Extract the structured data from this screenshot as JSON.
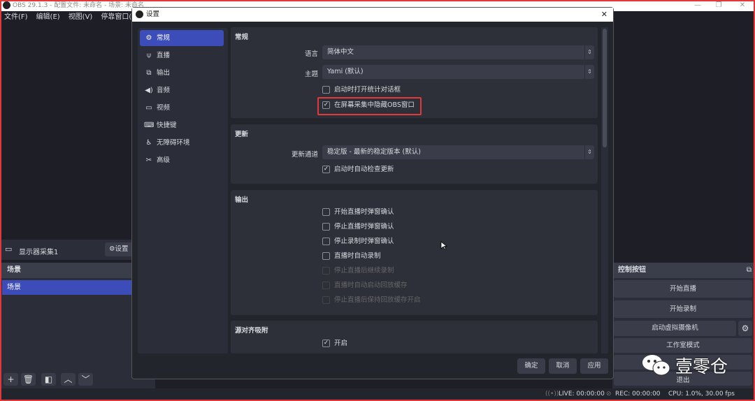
{
  "app": {
    "title": "OBS 29.1.3 - 配置文件: 未命名 - 场景: 未命名",
    "window_controls": [
      "minimize",
      "restore",
      "close"
    ]
  },
  "menu": [
    "文件(F)",
    "编辑(E)",
    "视图(V)",
    "停靠窗口(D)"
  ],
  "source_toolbar": {
    "source_name": "显示器采集1",
    "settings_label": "设置"
  },
  "scenes": {
    "header": "场景",
    "items": [
      "场景"
    ],
    "selected": 0
  },
  "controls": {
    "header": "控制按钮",
    "buttons": [
      "开始直播",
      "开始录制",
      "启动虚拟摄像机",
      "工作室模式",
      "",
      "退出"
    ]
  },
  "status": {
    "live": "LIVE: 00:00:00",
    "rec": "REC: 00:00:00",
    "cpu": "CPU: 1.0%, 30.00 fps"
  },
  "watermark": {
    "text": "壹零仓"
  },
  "settings": {
    "title": "设置",
    "sidebar": [
      {
        "label": "常规",
        "icon": "gear-icon"
      },
      {
        "label": "直播",
        "icon": "antenna-icon"
      },
      {
        "label": "输出",
        "icon": "output-icon"
      },
      {
        "label": "音频",
        "icon": "speaker-icon"
      },
      {
        "label": "视频",
        "icon": "monitor-icon"
      },
      {
        "label": "快捷键",
        "icon": "keyboard-icon"
      },
      {
        "label": "无障碍环境",
        "icon": "accessibility-icon"
      },
      {
        "label": "高级",
        "icon": "tools-icon"
      }
    ],
    "active": 0,
    "general": {
      "header": "常规",
      "language_label": "语言",
      "language": "简体中文",
      "theme_label": "主题",
      "theme": "Yami (默认)",
      "open_stats": "启动时打开统计对话框",
      "hide_obs": "在屏幕采集中隐藏OBS窗口",
      "open_stats_checked": false,
      "hide_obs_checked": true
    },
    "update": {
      "header": "更新",
      "channel_label": "更新通道",
      "channel": "稳定版 - 最新的稳定版本 (默认)",
      "auto_check": "启动时自动检查更新",
      "auto_check_checked": true
    },
    "output": {
      "header": "输出",
      "options": [
        {
          "label": "开始直播时弹窗确认",
          "checked": false,
          "disabled": false
        },
        {
          "label": "停止直播时弹窗确认",
          "checked": false,
          "disabled": false
        },
        {
          "label": "停止录制时弹窗确认",
          "checked": false,
          "disabled": false
        },
        {
          "label": "直播时自动录制",
          "checked": false,
          "disabled": false
        },
        {
          "label": "停止直播后继续录制",
          "checked": false,
          "disabled": true
        },
        {
          "label": "直播时自动启动回放缓存",
          "checked": false,
          "disabled": true
        },
        {
          "label": "停止直播后保持回放缓存开启",
          "checked": false,
          "disabled": true
        }
      ]
    },
    "snapping": {
      "header": "源对齐吸附",
      "enable": "开启",
      "enable_checked": true
    },
    "buttons": {
      "ok": "确定",
      "cancel": "取消",
      "apply": "应用"
    }
  },
  "colors": {
    "accent": "#3c4cb8",
    "highlight": "#e0393a"
  }
}
